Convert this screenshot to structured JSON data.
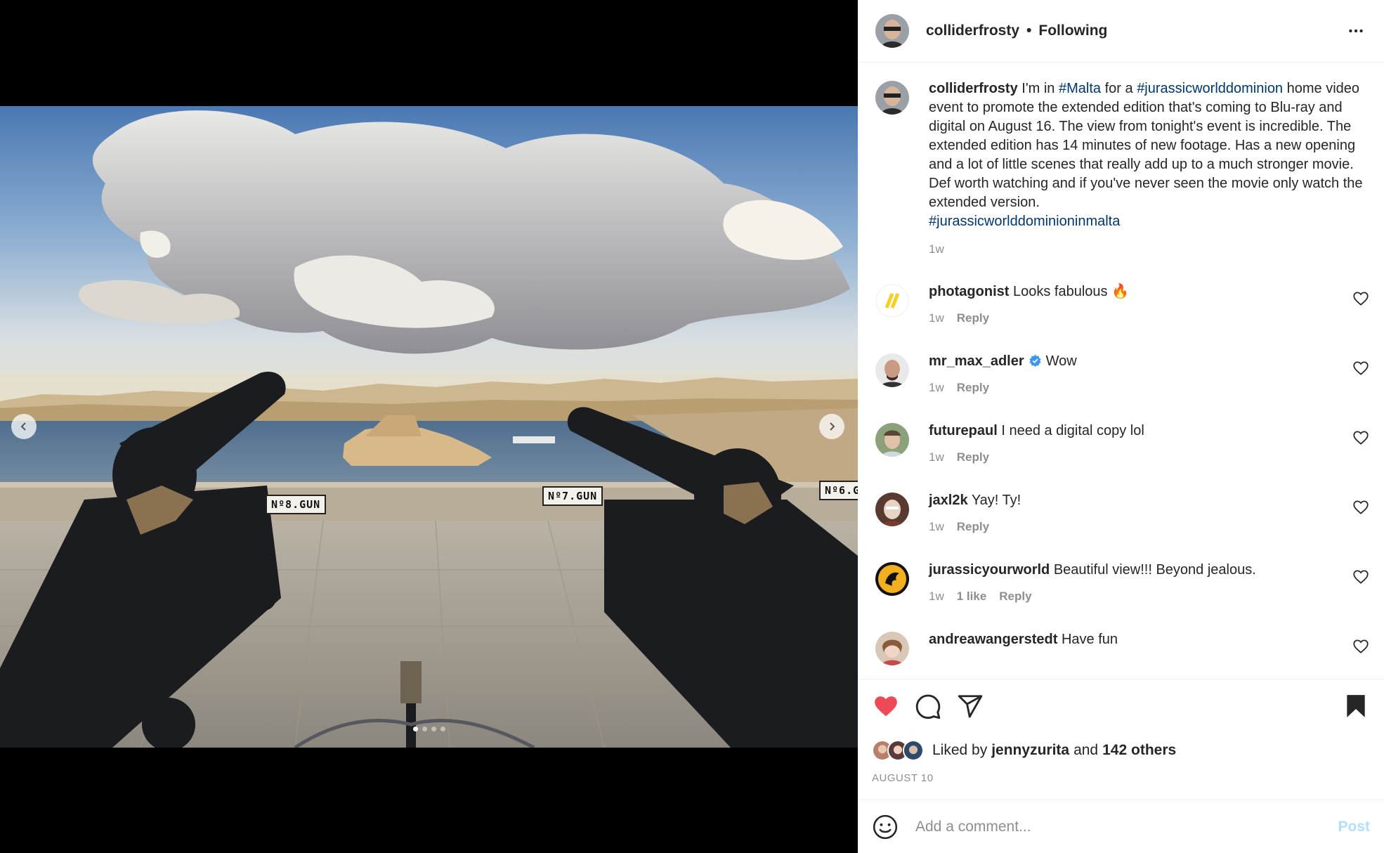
{
  "header": {
    "username": "colliderfrosty",
    "separator": "•",
    "follow_status": "Following",
    "more_icon": "more-horizontal-icon"
  },
  "media": {
    "gun_plates": [
      "Nº8.GUN",
      "Nº7.GUN",
      "Nº6.G"
    ],
    "current_slide": 1,
    "slide_count": 4
  },
  "caption": {
    "username": "colliderfrosty",
    "text_1": "I'm in",
    "tag_1": "#Malta",
    "text_2": "for a",
    "tag_2": "#jurassicworlddominion",
    "text_3": "home video event to promote the extended edition that's coming to Blu-ray and digital on August 16. The view from tonight's event is incredible. The extended edition has 14 minutes of new footage. Has a new opening and a lot of little scenes that really add up to a much stronger movie. Def worth watching and if you've never seen the movie only watch the extended version.",
    "tag_3": "#jurassicworlddominioninmalta",
    "time": "1w"
  },
  "comments": [
    {
      "username": "photagonist",
      "text": "Looks fabulous 🔥",
      "time": "1w",
      "likes": "",
      "reply": "Reply",
      "verified": false
    },
    {
      "username": "mr_max_adler",
      "text": "Wow",
      "time": "1w",
      "likes": "",
      "reply": "Reply",
      "verified": true
    },
    {
      "username": "futurepaul",
      "text": "I need a digital copy lol",
      "time": "1w",
      "likes": "",
      "reply": "Reply",
      "verified": false
    },
    {
      "username": "jaxl2k",
      "text": "Yay! Ty!",
      "time": "1w",
      "likes": "",
      "reply": "Reply",
      "verified": false
    },
    {
      "username": "jurassicyourworld",
      "text": "Beautiful view!!! Beyond jealous.",
      "time": "1w",
      "likes": "1 like",
      "reply": "Reply",
      "verified": false
    },
    {
      "username": "andreawangerstedt",
      "text": "Have fun",
      "time": "",
      "likes": "",
      "reply": "",
      "verified": false
    }
  ],
  "actions": {
    "liked": true,
    "like_icon": "heart-filled-icon",
    "comment_icon": "comment-bubble-icon",
    "share_icon": "paper-plane-icon",
    "save_icon": "bookmark-filled-icon"
  },
  "likes": {
    "prefix": "Liked by",
    "user": "jennyzurita",
    "joiner": "and",
    "others": "142 others"
  },
  "date": "AUGUST 10",
  "add_comment": {
    "placeholder": "Add a comment...",
    "post_label": "Post",
    "emoji_icon": "smiley-icon"
  },
  "colors": {
    "like_red": "#ed4956",
    "hashtag": "#00376b",
    "post_disabled": "#b2dffc",
    "verified_blue": "#3897f0"
  }
}
